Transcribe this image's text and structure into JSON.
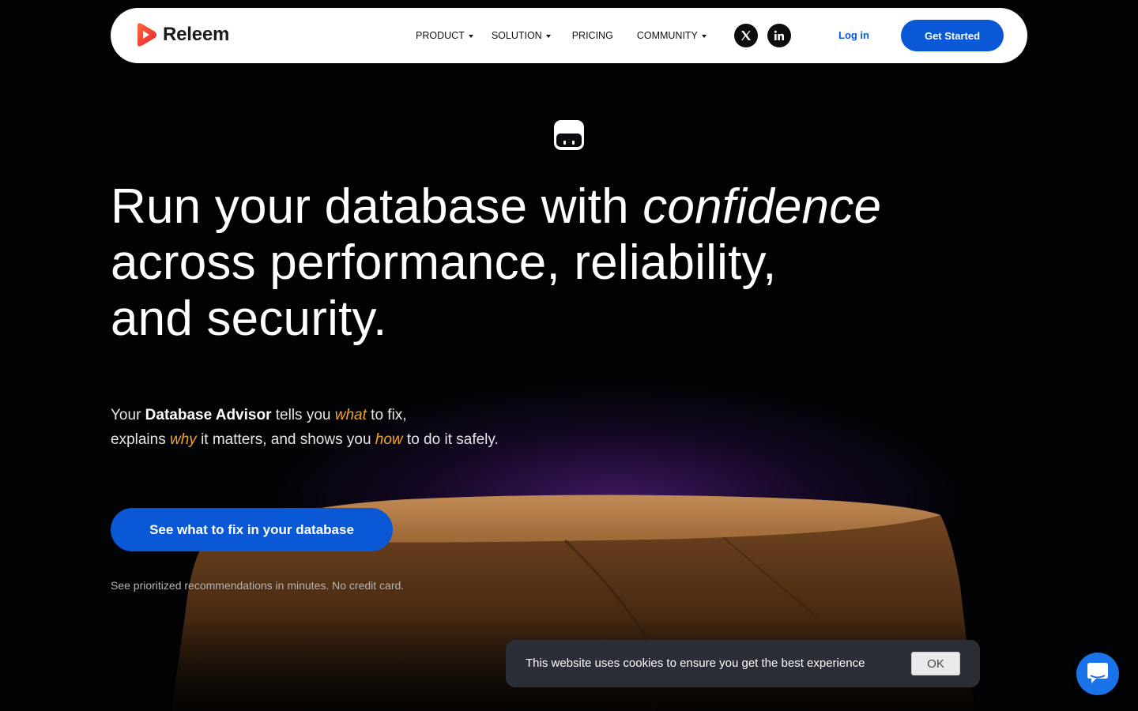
{
  "header": {
    "logo_text": "Releem",
    "nav": [
      {
        "label": "PRODUCT",
        "dropdown": true
      },
      {
        "label": "SOLUTION",
        "dropdown": true
      },
      {
        "label": "PRICING",
        "dropdown": false
      },
      {
        "label": "COMMUNITY",
        "dropdown": true
      }
    ],
    "social": [
      "x-icon",
      "linkedin-icon"
    ],
    "login_label": "Log in",
    "cta_label": "Get Started"
  },
  "hero": {
    "headline_part1": "Run your database with ",
    "headline_em": "confidence",
    "headline_line2": "across performance, reliability,",
    "headline_line3": "and security.",
    "sub": {
      "t1": "Your ",
      "bold": "Database Advisor",
      "t2": " tells you ",
      "what": "what",
      "t3": " to fix,",
      "t4": "explains ",
      "why": "why",
      "t5": " it matters, and shows you ",
      "how": "how",
      "t6": " to do it safely."
    },
    "cta_label": "See what to fix in your database",
    "note": "See prioritized recommendations in minutes. No credit card."
  },
  "cookie": {
    "text": "This website uses cookies to ensure you get the best experience",
    "ok_label": "OK"
  },
  "colors": {
    "accent": "#0a58d6",
    "highlight": "#f0a52a",
    "background": "#020305"
  }
}
